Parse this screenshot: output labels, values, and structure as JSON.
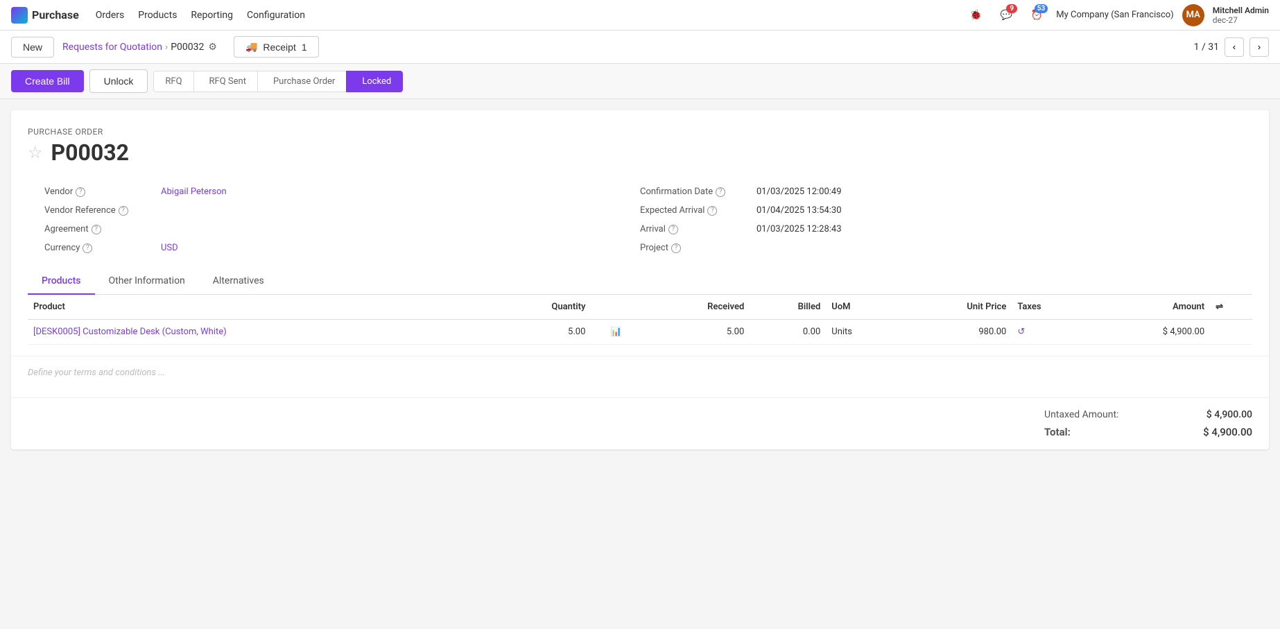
{
  "app": {
    "logo_text": "Purchase",
    "nav_items": [
      "Orders",
      "Products",
      "Reporting",
      "Configuration"
    ]
  },
  "topnav": {
    "bug_icon": "🐞",
    "chat_badge": "9",
    "activity_badge": "53",
    "company": "My Company (San Francisco)",
    "user_name": "Mitchell Admin",
    "user_date": "dec-27",
    "user_initials": "MA"
  },
  "breadcrumb": {
    "new_label": "New",
    "parent_label": "Requests for Quotation",
    "current_label": "P00032",
    "receipt_label": "Receipt",
    "receipt_count": "1",
    "pager_text": "1 / 31"
  },
  "actions": {
    "create_bill_label": "Create Bill",
    "unlock_label": "Unlock"
  },
  "status_steps": [
    {
      "label": "RFQ",
      "active": false
    },
    {
      "label": "RFQ Sent",
      "active": false
    },
    {
      "label": "Purchase Order",
      "active": false
    },
    {
      "label": "Locked",
      "active": true
    }
  ],
  "form": {
    "section_label": "Purchase Order",
    "order_number": "P00032",
    "vendor_label": "Vendor",
    "vendor_help": "?",
    "vendor_value": "Abigail Peterson",
    "vendor_ref_label": "Vendor Reference",
    "vendor_ref_help": "?",
    "vendor_ref_value": "",
    "agreement_label": "Agreement",
    "agreement_help": "?",
    "agreement_value": "",
    "currency_label": "Currency",
    "currency_help": "?",
    "currency_value": "USD",
    "confirmation_date_label": "Confirmation Date",
    "confirmation_date_help": "?",
    "confirmation_date_value": "01/03/2025 12:00:49",
    "expected_arrival_label": "Expected Arrival",
    "expected_arrival_help": "?",
    "expected_arrival_value": "01/04/2025 13:54:30",
    "arrival_label": "Arrival",
    "arrival_help": "?",
    "arrival_value": "01/03/2025 12:28:43",
    "project_label": "Project",
    "project_help": "?",
    "project_value": ""
  },
  "tabs": [
    {
      "label": "Products",
      "active": true
    },
    {
      "label": "Other Information",
      "active": false
    },
    {
      "label": "Alternatives",
      "active": false
    }
  ],
  "table": {
    "columns": [
      "Product",
      "Quantity",
      "",
      "Received",
      "Billed",
      "UoM",
      "Unit Price",
      "Taxes",
      "Amount",
      "⇌"
    ],
    "rows": [
      {
        "product": "[DESK0005] Customizable Desk (Custom, White)",
        "quantity": "5.00",
        "received": "5.00",
        "billed": "0.00",
        "uom": "Units",
        "unit_price": "980.00",
        "taxes": "",
        "amount": "$ 4,900.00"
      }
    ]
  },
  "terms": {
    "placeholder": "Define your terms and conditions ..."
  },
  "totals": {
    "untaxed_label": "Untaxed Amount:",
    "untaxed_value": "$ 4,900.00",
    "total_label": "Total:",
    "total_value": "$ 4,900.00"
  }
}
